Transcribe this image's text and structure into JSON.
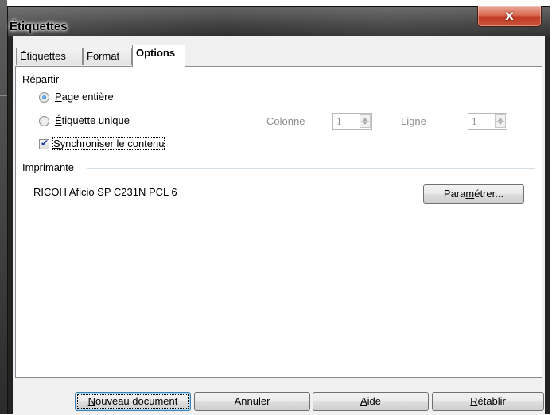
{
  "window": {
    "title": "Étiquettes",
    "close_glyph": "x",
    "colors": {
      "close_button": "#c9563c",
      "frame": "#3e3e3e"
    }
  },
  "tabs": [
    {
      "label": "Étiquettes",
      "active": false
    },
    {
      "label": "Format",
      "active": false
    },
    {
      "label": "Options",
      "active": true
    }
  ],
  "repartir": {
    "title": "Répartir",
    "options": [
      {
        "label_mn": "P",
        "label_rest": "age entière",
        "selected": true
      },
      {
        "label_mn": "É",
        "label_rest": "tiquette unique",
        "selected": false
      }
    ],
    "sync": {
      "label_mn": "S",
      "label_rest": "ynchroniser le contenu",
      "checked": true
    },
    "colonne": {
      "label_mn": "C",
      "label_rest": "olonne",
      "value": "1",
      "enabled": false
    },
    "ligne": {
      "label_mn": "L",
      "label_rest": "igne",
      "value": "1",
      "enabled": false
    }
  },
  "imprimante": {
    "title": "Imprimante",
    "printer_name": "RICOH Aficio SP C231N PCL 6",
    "setup_button": {
      "pre": "Para",
      "mn": "m",
      "post": "étrer..."
    }
  },
  "buttons": {
    "new_document": {
      "mn": "N",
      "rest": "ouveau document"
    },
    "cancel": "Annuler",
    "help": {
      "mn": "A",
      "rest": "ide"
    },
    "reset": {
      "mn": "R",
      "rest": "établir"
    }
  }
}
